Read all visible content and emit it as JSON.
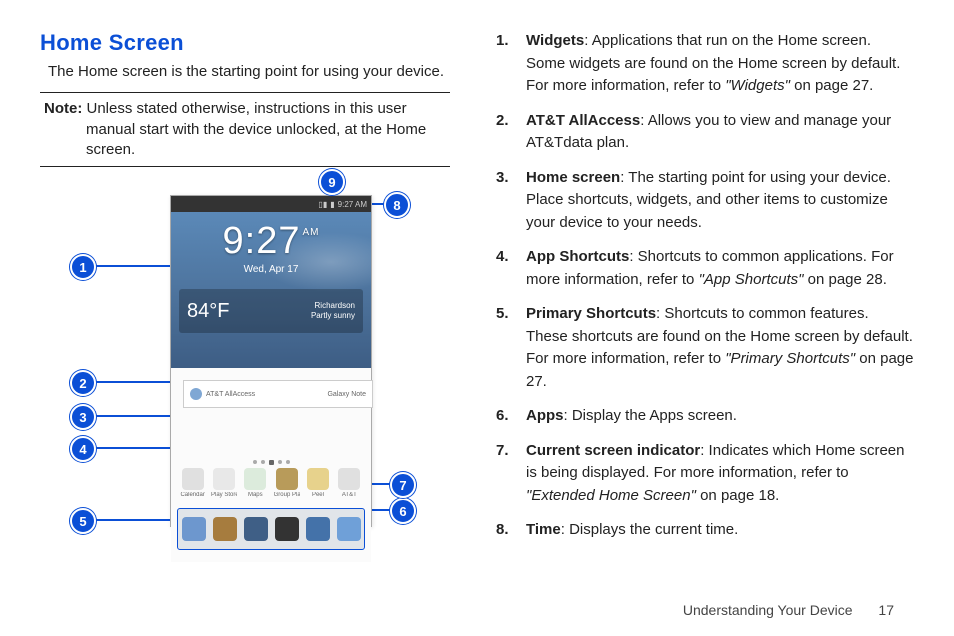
{
  "title": "Home Screen",
  "intro": "The Home screen is the starting point for using your device.",
  "note_label": "Note:",
  "note_text": "Unless stated otherwise, instructions in this user manual start with the device unlocked, at the Home screen.",
  "device": {
    "status_time": "9:27 AM",
    "clock_time": "9:27",
    "clock_ampm": "AM",
    "date": "Wed, Apr 17",
    "weather_temp": "84°F",
    "weather_loc_city": "Richardson",
    "weather_loc_cond": "Partly sunny",
    "allaccess_label": "AT&T AllAccess",
    "allaccess_sub": "Galaxy Note",
    "app_icons": [
      {
        "label": "Calendar",
        "color": "#e0e0e0"
      },
      {
        "label": "Play Store",
        "color": "#e8e8e8"
      },
      {
        "label": "Maps",
        "color": "#dcebdc"
      },
      {
        "label": "Group Play",
        "color": "#b89b5a"
      },
      {
        "label": "Peel",
        "color": "#e7d28c"
      },
      {
        "label": "AT&T",
        "color": "#e0e0e0"
      }
    ],
    "tray_icons": [
      {
        "color": "#6d97ce"
      },
      {
        "color": "#a67c3e"
      },
      {
        "color": "#3f5f86"
      },
      {
        "color": "#333333"
      },
      {
        "color": "#4472a9"
      },
      {
        "color": "#6fa0d8"
      }
    ]
  },
  "callouts": {
    "c1": "1",
    "c2": "2",
    "c3": "3",
    "c4": "4",
    "c5": "5",
    "c6": "6",
    "c7": "7",
    "c8": "8",
    "c9": "9"
  },
  "legend": [
    {
      "term": "Widgets",
      "text": ": Applications that run on the Home screen. Some widgets are found on the Home screen by default. For more information, refer to ",
      "ref": "\"Widgets\"",
      "after": " on page 27."
    },
    {
      "term": "AT&T AllAccess",
      "text": ": Allows you to view and manage your AT&Tdata plan.",
      "ref": "",
      "after": ""
    },
    {
      "term": "Home screen",
      "text": ": The starting point for using your device. Place shortcuts, widgets, and other items to customize your device to your needs.",
      "ref": "",
      "after": ""
    },
    {
      "term": "App Shortcuts",
      "text": ": Shortcuts to common applications. For more information, refer to ",
      "ref": "\"App Shortcuts\"",
      "after": " on page 28."
    },
    {
      "term": "Primary Shortcuts",
      "text": ": Shortcuts to common features. These shortcuts are found on the Home screen by default. For more information, refer to ",
      "ref": "\"Primary Shortcuts\"",
      "after": " on page 27."
    },
    {
      "term": "Apps",
      "text": ": Display the Apps screen.",
      "ref": "",
      "after": ""
    },
    {
      "term": "Current screen indicator",
      "text": ": Indicates which Home screen is being displayed. For more information, refer to ",
      "ref": "\"Extended Home Screen\"",
      "after": " on page 18."
    },
    {
      "term": "Time",
      "text": ": Displays the current time.",
      "ref": "",
      "after": ""
    }
  ],
  "footer_section": "Understanding Your Device",
  "footer_page": "17"
}
